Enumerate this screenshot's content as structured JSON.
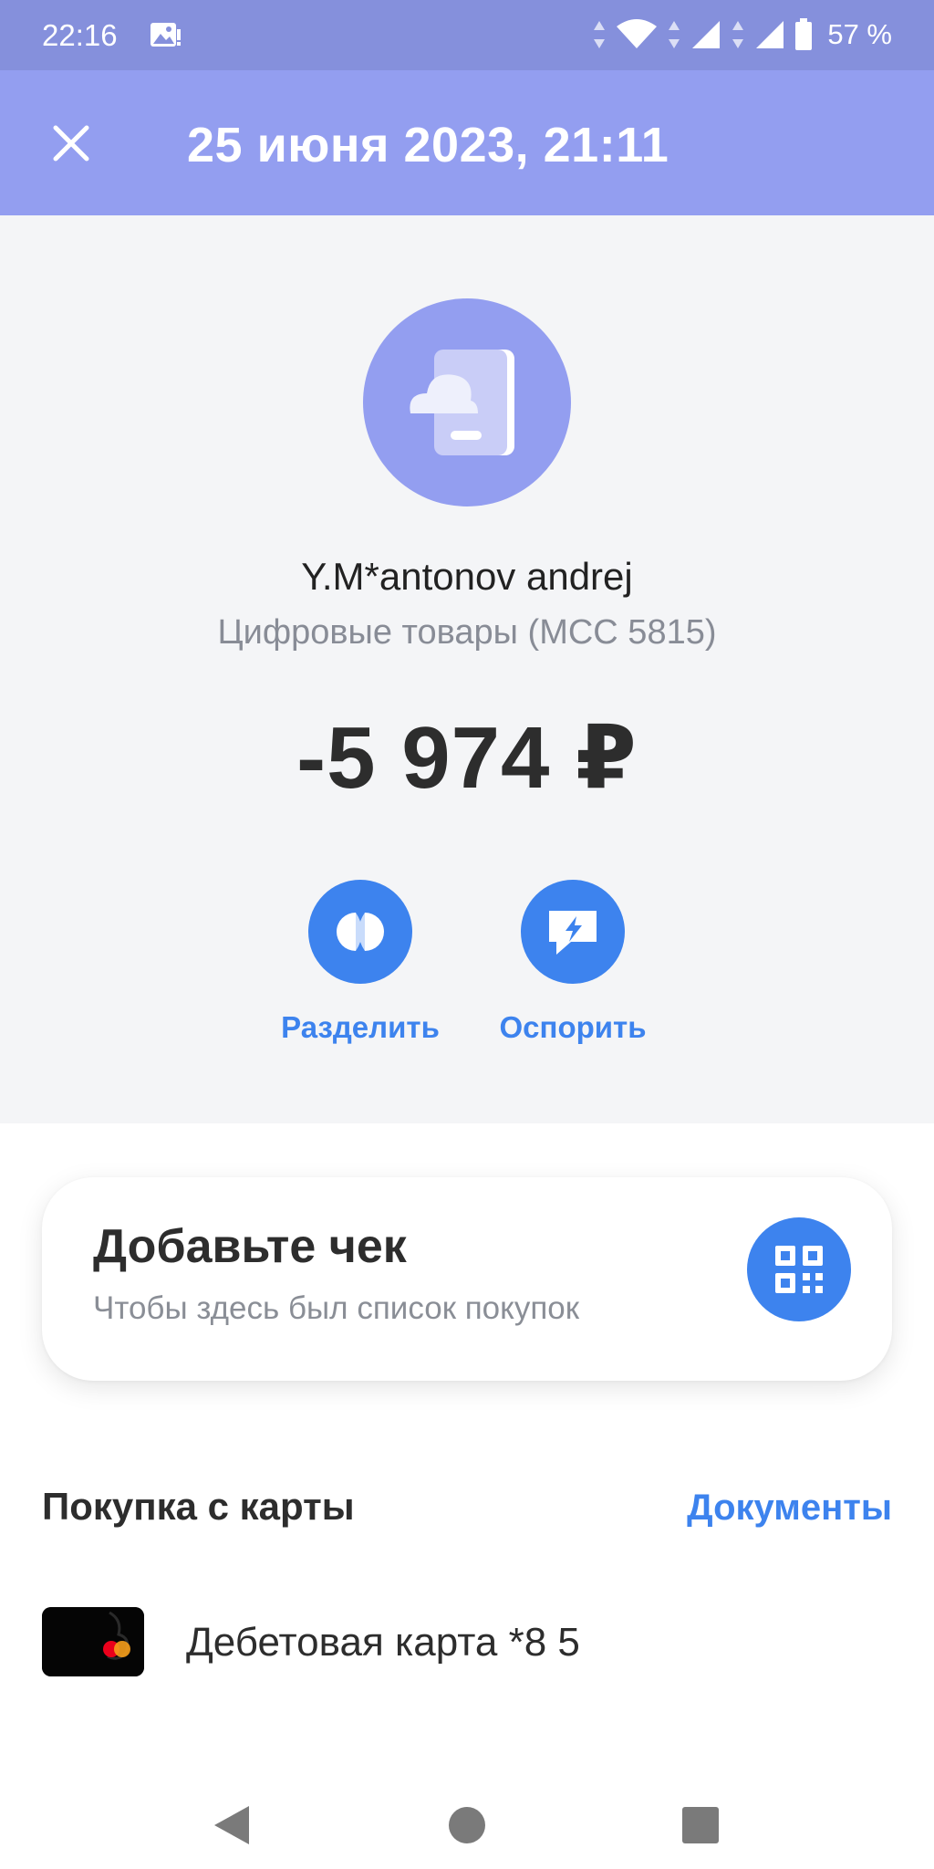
{
  "status_bar": {
    "time": "22:16",
    "battery_text": "57 %",
    "icons": [
      "gallery-icon",
      "wifi-icon",
      "signal-icon",
      "signal-icon",
      "battery-icon"
    ]
  },
  "header": {
    "title": "25 июня 2023, 21:11",
    "close_icon": "close-icon"
  },
  "transaction": {
    "merchant_name": "Y.M*antonov andrej",
    "category": "Цифровые товары (MCC 5815)",
    "amount": "-5 974 ₽"
  },
  "actions": [
    {
      "label": "Разделить",
      "icon": "split-icon"
    },
    {
      "label": "Оспорить",
      "icon": "dispute-icon"
    }
  ],
  "receipt": {
    "title": "Добавьте чек",
    "subtitle": "Чтобы здесь был список покупок",
    "icon": "qr-code-icon"
  },
  "payment_source": {
    "section_title": "Покупка с карты",
    "documents_link": "Документы",
    "card_label": "Дебетовая карта *8   5"
  },
  "colors": {
    "status_bar": "#8590dc",
    "header": "#939ef0",
    "accent": "#3d83ee",
    "hero_background": "#f4f5f7"
  }
}
